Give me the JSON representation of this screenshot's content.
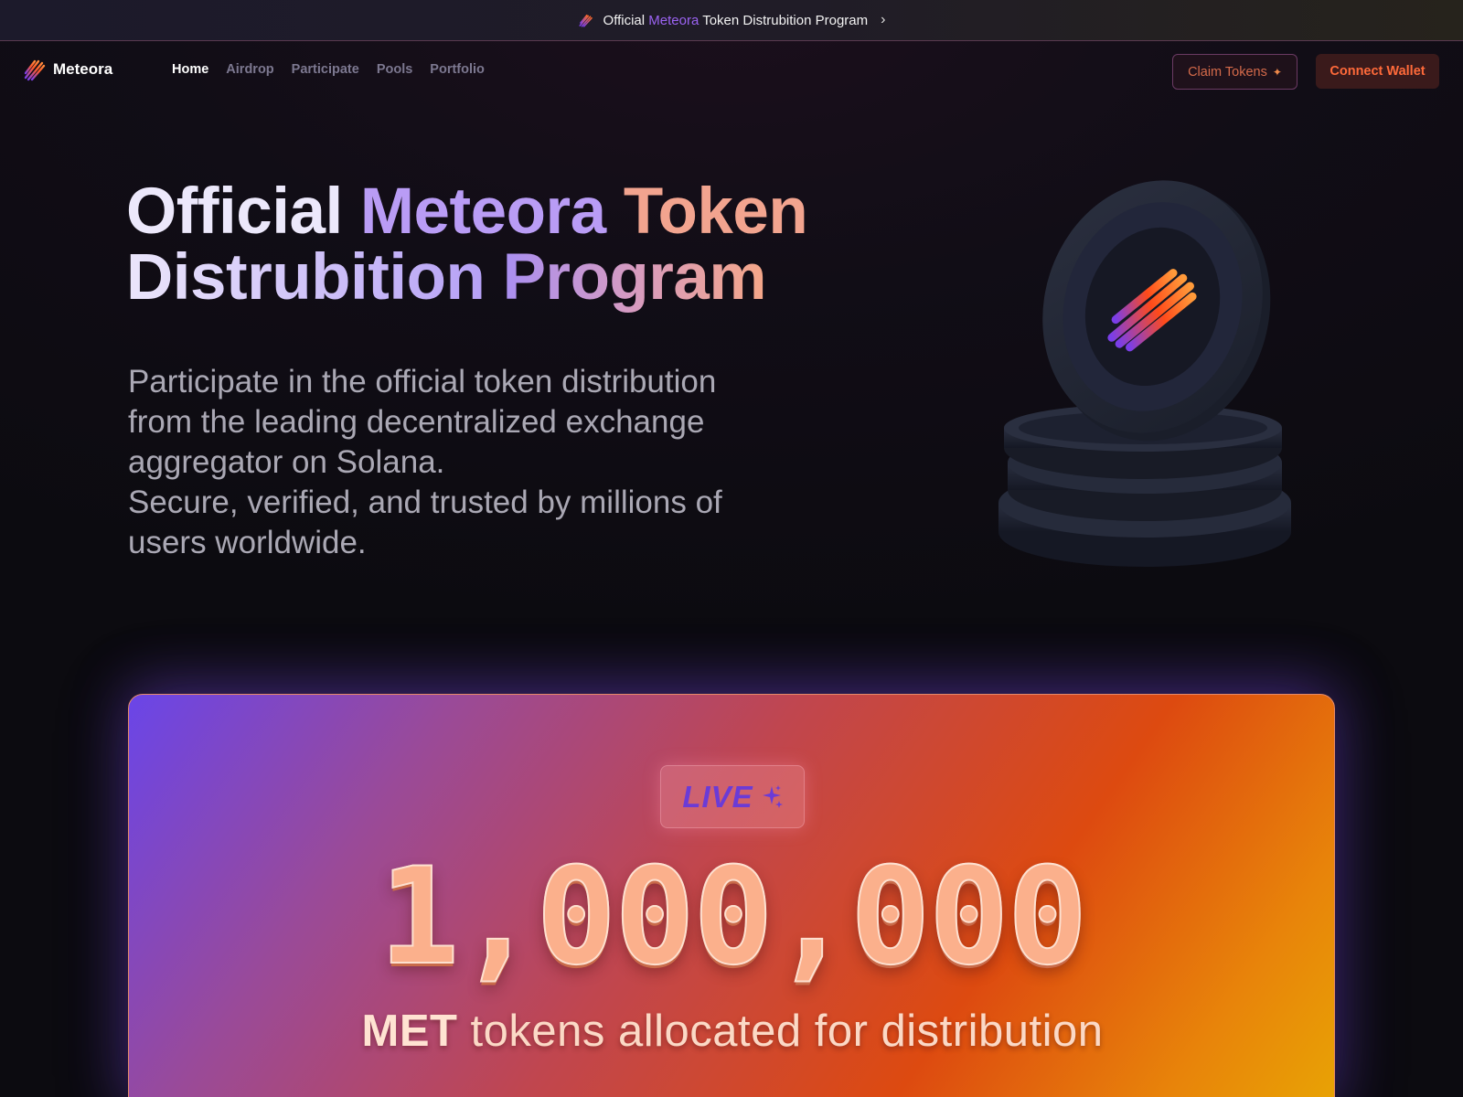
{
  "announcement": {
    "prefix": "Official",
    "highlight_purple": "Meteora",
    "suffix": "Token Distrubition Program",
    "chevron": "›"
  },
  "nav": {
    "brand": "Meteora",
    "links": [
      "Home",
      "Airdrop",
      "Participate",
      "Pools",
      "Portfolio"
    ],
    "active_link": "Home",
    "claim_label": "Claim Tokens",
    "connect_label": "Connect Wallet"
  },
  "hero": {
    "title_word_1": "Official",
    "title_word_2": "Meteora",
    "title_word_3": "Token",
    "title_word_4": "Distrubition",
    "title_word_5": "Program",
    "subtitle_line_1": "Participate in the official token distribution from the leading decentralized exchange aggregator on Solana.",
    "subtitle_line_2": "Secure, verified, and trusted by millions of users worldwide."
  },
  "distribution": {
    "badge": "LIVE",
    "amount": "1,000,000",
    "token": "MET",
    "caption": "tokens allocated for distribution"
  },
  "colors": {
    "accent_purple": "#9b63f2",
    "accent_orange": "#f06a3c",
    "background": "#0d0c12"
  },
  "icons": {
    "brand_logo": "meteora-logo-icon",
    "sparkle": "sparkle-icon",
    "chevron": "chevron-right-icon"
  }
}
